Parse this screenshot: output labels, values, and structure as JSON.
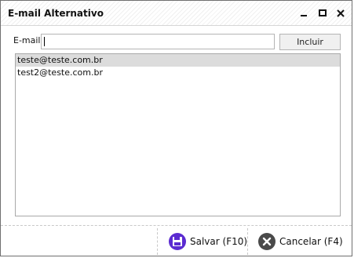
{
  "window": {
    "title": "E-mail Alternativo",
    "controls": [
      "minimize-icon",
      "maximize-icon",
      "close-icon"
    ]
  },
  "form": {
    "email_label": "E-mail",
    "email_value": "",
    "add_button_label": "Incluir"
  },
  "emails": [
    {
      "address": "teste@teste.com.br",
      "selected": true
    },
    {
      "address": "test2@teste.com.br",
      "selected": false
    }
  ],
  "footer": {
    "save_label": "Salvar (F10)",
    "save_icon": "floppy-disk-icon",
    "save_color": "#5b2bd1",
    "cancel_label": "Cancelar (F4)",
    "cancel_icon": "cancel-x-icon",
    "cancel_color": "#4a4a4a"
  }
}
